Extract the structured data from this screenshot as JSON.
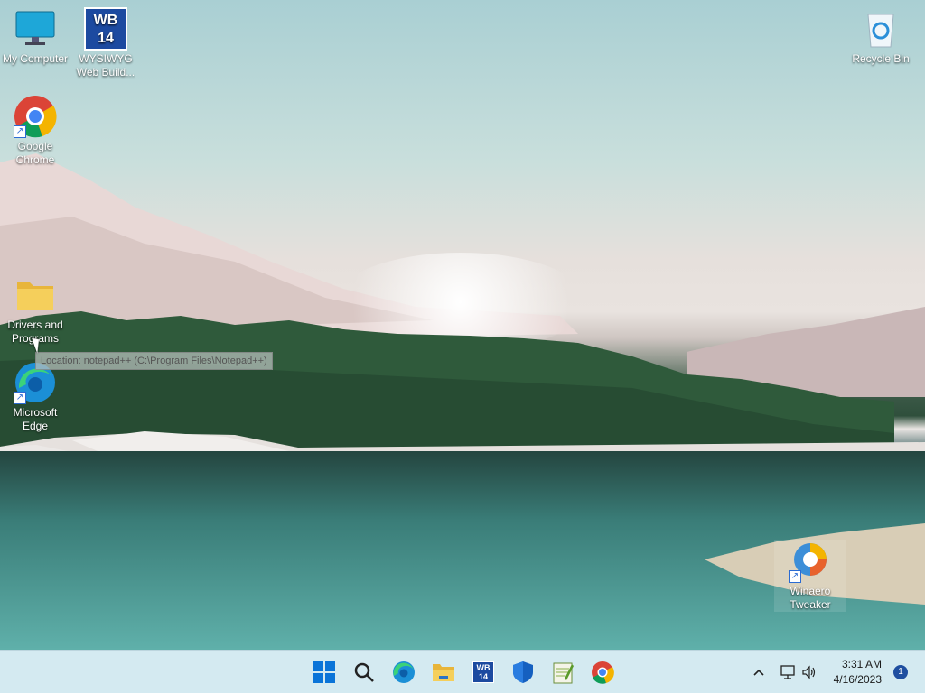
{
  "desktop": {
    "icons": [
      {
        "label": "My Computer",
        "icon": "monitor-icon"
      },
      {
        "label": "WYSIWYG Web Build...",
        "icon": "wb14-icon",
        "badge": "WB 14"
      },
      {
        "label": "Recycle Bin",
        "icon": "recycle-bin-icon"
      },
      {
        "label": "Google Chrome",
        "icon": "chrome-icon"
      },
      {
        "label": "Drivers and Programs",
        "icon": "folder-icon"
      },
      {
        "label": "Microsoft Edge",
        "icon": "edge-icon"
      },
      {
        "label": "Winaero Tweaker",
        "icon": "winaero-icon"
      }
    ],
    "tooltip": "Location: notepad++ (C:\\Program Files\\Notepad++)"
  },
  "taskbar": {
    "apps": [
      {
        "name": "Start",
        "icon": "windows-start-icon"
      },
      {
        "name": "Search",
        "icon": "search-icon"
      },
      {
        "name": "Microsoft Edge",
        "icon": "edge-icon"
      },
      {
        "name": "File Explorer",
        "icon": "folder-icon"
      },
      {
        "name": "WYSIWYG Web Builder",
        "icon": "wb14-icon",
        "badge": "WB 14"
      },
      {
        "name": "Windows Security",
        "icon": "shield-icon"
      },
      {
        "name": "Notepad++",
        "icon": "notepad-icon"
      },
      {
        "name": "Google Chrome",
        "icon": "chrome-icon"
      }
    ],
    "tray": {
      "time": "3:31 AM",
      "date": "4/16/2023",
      "notification_count": "1"
    }
  },
  "colors": {
    "taskbar_bg": "#d4eaf1",
    "accent": "#0a64d8"
  }
}
